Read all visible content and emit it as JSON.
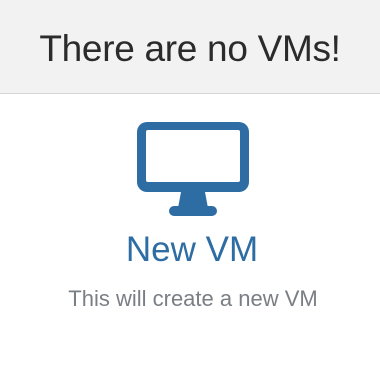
{
  "header": {
    "title": "There are no VMs!"
  },
  "new_vm": {
    "label": "New VM",
    "description": "This will create a new VM",
    "icon": "monitor-icon",
    "accent_color": "#2e6da4"
  }
}
